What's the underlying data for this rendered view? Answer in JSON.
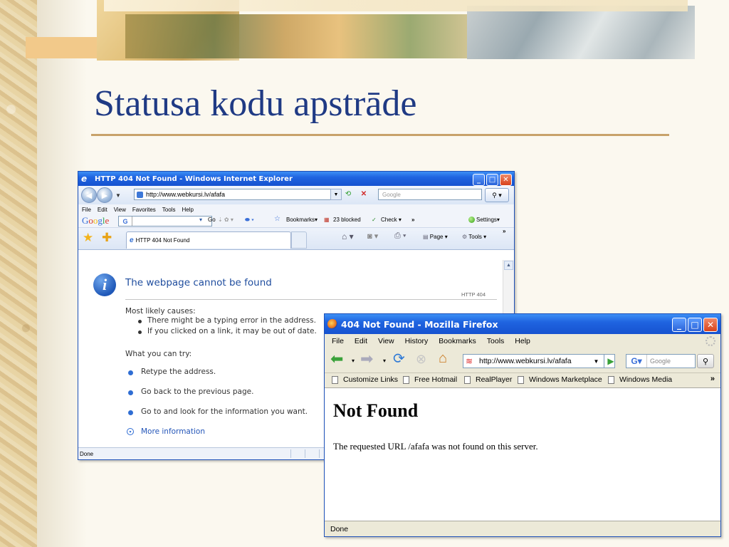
{
  "slide": {
    "title": "Statusa kodu apstrāde"
  },
  "ie": {
    "window_title": "HTTP 404 Not Found - Windows Internet Explorer",
    "address": "http://www.webkursi.lv/afafa",
    "search_placeholder": "Google",
    "menu": [
      "File",
      "Edit",
      "View",
      "Favorites",
      "Tools",
      "Help"
    ],
    "google_bar": {
      "logo": "Google",
      "go": "Go",
      "bookmarks": "Bookmarks▾",
      "blocked": "23 blocked",
      "check": "Check ▾",
      "more": "»",
      "settings": "Settings▾"
    },
    "tab_title": "HTTP 404 Not Found",
    "cmd": {
      "page": "Page ▾",
      "tools": "Tools ▾",
      "more": "»"
    },
    "content": {
      "heading": "The webpage cannot be found",
      "code": "HTTP 404",
      "causes_title": "Most likely causes:",
      "causes": [
        "There might be a typing error in the address.",
        "If you clicked on a link, it may be out of date."
      ],
      "try_title": "What you can try:",
      "tries": [
        "Retype the address.",
        "Go back to the previous page.",
        "Go to  and look for the information you want."
      ],
      "more_info": "More information"
    },
    "status": "Done"
  },
  "ff": {
    "window_title": "404 Not Found - Mozilla Firefox",
    "menu": [
      "File",
      "Edit",
      "View",
      "History",
      "Bookmarks",
      "Tools",
      "Help"
    ],
    "address": "http://www.webkursi.lv/afafa",
    "search_placeholder": "Google",
    "bookmarks": [
      "Customize Links",
      "Free Hotmail",
      "RealPlayer",
      "Windows Marketplace",
      "Windows Media"
    ],
    "bookmarks_more": "»",
    "heading": "Not Found",
    "message": "The requested URL /afafa was not found on this server.",
    "status": "Done"
  }
}
